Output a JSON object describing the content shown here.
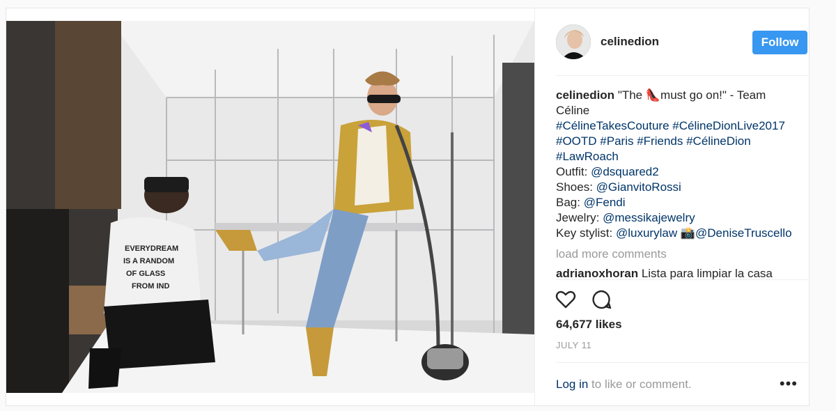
{
  "post": {
    "username": "celinedion",
    "follow_label": "Follow",
    "caption": {
      "username": "celinedion",
      "text_before_emoji": "\"The ",
      "emoji": "👠",
      "text_after_emoji": "must go on!\" - Team",
      "text_line2": "Céline",
      "hashtags_line1": [
        "#CélineTakesCouture",
        "#CélineDionLive2017"
      ],
      "hashtags_line2": [
        "#OOTD",
        "#Paris",
        "#Friends",
        "#CélineDion"
      ],
      "hashtags_line3": [
        "#LawRoach"
      ],
      "credits": [
        {
          "label": "Outfit:",
          "mention": "@dsquared2"
        },
        {
          "label": "Shoes:",
          "mention": "@GianvitoRossi"
        },
        {
          "label": "Bag:",
          "mention": "@Fendi"
        },
        {
          "label": "Jewelry:",
          "mention": "@messikajewelry"
        }
      ],
      "stylist_label": "Key stylist:",
      "stylist_mention": "@luxurylaw",
      "camera_emoji": "📸",
      "photographer_mention": "@DeniseTruscello"
    },
    "load_more": "load more comments",
    "next_comment": {
      "username": "adrianoxhoran",
      "text": "Lista para limpiar la casa"
    },
    "likes": "64,677 likes",
    "date": "JULY 11",
    "footer": {
      "login": "Log in",
      "rest": " to like or comment.",
      "more": "•••"
    },
    "icons": [
      "heart-icon",
      "comment-icon",
      "more-options-icon"
    ],
    "colors": {
      "follow_button": "#3897f0",
      "link": "#003569",
      "muted": "#999999"
    }
  }
}
